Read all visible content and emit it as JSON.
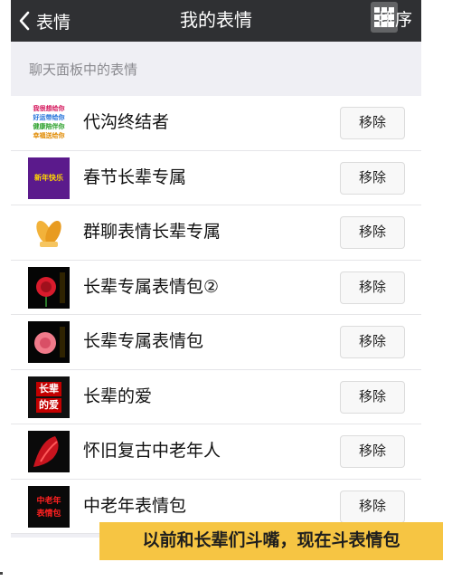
{
  "navbar": {
    "back_label": "表情",
    "title": "我的表情",
    "sort_label": "排序",
    "bg_color": "#2f3033"
  },
  "section": {
    "header": "聊天面板中的表情"
  },
  "stickers": [
    {
      "name": "代沟终结者",
      "remove_label": "移除",
      "thumb_icon": "colorful-text-sticker",
      "thumb_text": [
        "我很想给你",
        "好运带给你",
        "健康陪伴你",
        "幸福送给你"
      ]
    },
    {
      "name": "春节长辈专属",
      "remove_label": "移除",
      "thumb_icon": "new-year-sticker",
      "thumb_text": [
        "新年快乐"
      ]
    },
    {
      "name": "群聊表情长辈专属",
      "remove_label": "移除",
      "thumb_icon": "folded-hands-sticker"
    },
    {
      "name": "长辈专属表情包②",
      "remove_label": "移除",
      "thumb_icon": "red-rose-sticker"
    },
    {
      "name": "长辈专属表情包",
      "remove_label": "移除",
      "thumb_icon": "pink-rose-sticker"
    },
    {
      "name": "长辈的爱",
      "remove_label": "移除",
      "thumb_icon": "love-sticker",
      "thumb_text": [
        "长辈",
        "的爱"
      ]
    },
    {
      "name": "怀旧复古中老年人",
      "remove_label": "移除",
      "thumb_icon": "red-scarf-sticker"
    },
    {
      "name": "中老年表情包",
      "remove_label": "移除",
      "thumb_icon": "red-text-sticker",
      "thumb_text": [
        "中老年",
        "表情包"
      ]
    }
  ],
  "caption": {
    "text": "以前和长辈们斗嘴，现在斗表情包",
    "bg_color": "#f6c543"
  }
}
